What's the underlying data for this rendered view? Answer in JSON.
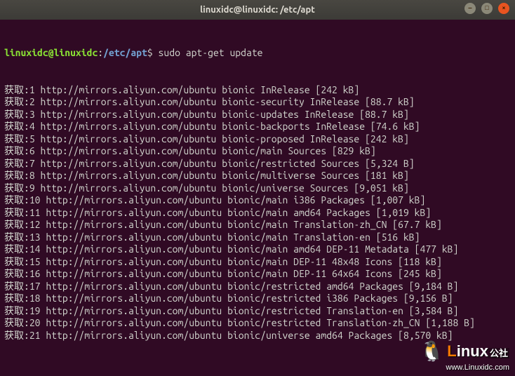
{
  "titlebar": {
    "title": "linuxidc@linuxidc: /etc/apt"
  },
  "prompt": {
    "userhost": "linuxidc@linuxidc",
    "colon": ":",
    "path": "/etc/apt",
    "dollar": "$ ",
    "command": "sudo apt-get update"
  },
  "lines": [
    "获取:1 http://mirrors.aliyun.com/ubuntu bionic InRelease [242 kB]",
    "获取:2 http://mirrors.aliyun.com/ubuntu bionic-security InRelease [88.7 kB]",
    "获取:3 http://mirrors.aliyun.com/ubuntu bionic-updates InRelease [88.7 kB]",
    "获取:4 http://mirrors.aliyun.com/ubuntu bionic-backports InRelease [74.6 kB]",
    "获取:5 http://mirrors.aliyun.com/ubuntu bionic-proposed InRelease [242 kB]",
    "获取:6 http://mirrors.aliyun.com/ubuntu bionic/main Sources [829 kB]",
    "获取:7 http://mirrors.aliyun.com/ubuntu bionic/restricted Sources [5,324 B]",
    "获取:8 http://mirrors.aliyun.com/ubuntu bionic/multiverse Sources [181 kB]",
    "获取:9 http://mirrors.aliyun.com/ubuntu bionic/universe Sources [9,051 kB]",
    "获取:10 http://mirrors.aliyun.com/ubuntu bionic/main i386 Packages [1,007 kB]",
    "获取:11 http://mirrors.aliyun.com/ubuntu bionic/main amd64 Packages [1,019 kB]",
    "获取:12 http://mirrors.aliyun.com/ubuntu bionic/main Translation-zh_CN [67.7 kB]",
    "获取:13 http://mirrors.aliyun.com/ubuntu bionic/main Translation-en [516 kB]",
    "获取:14 http://mirrors.aliyun.com/ubuntu bionic/main amd64 DEP-11 Metadata [477 kB]",
    "获取:15 http://mirrors.aliyun.com/ubuntu bionic/main DEP-11 48x48 Icons [118 kB]",
    "获取:16 http://mirrors.aliyun.com/ubuntu bionic/main DEP-11 64x64 Icons [245 kB]",
    "获取:17 http://mirrors.aliyun.com/ubuntu bionic/restricted amd64 Packages [9,184 B]",
    "获取:18 http://mirrors.aliyun.com/ubuntu bionic/restricted i386 Packages [9,156 B]",
    "获取:19 http://mirrors.aliyun.com/ubuntu bionic/restricted Translation-en [3,584 B]",
    "获取:20 http://mirrors.aliyun.com/ubuntu bionic/restricted Translation-zh_CN [1,188 B]",
    "获取:21 http://mirrors.aliyun.com/ubuntu bionic/universe amd64 Packages [8,570 kB]"
  ],
  "watermark": {
    "brand_prefix": "L",
    "brand_rest": "inux",
    "brand_cn": "公社",
    "url": "www.Linuxidc.com"
  }
}
